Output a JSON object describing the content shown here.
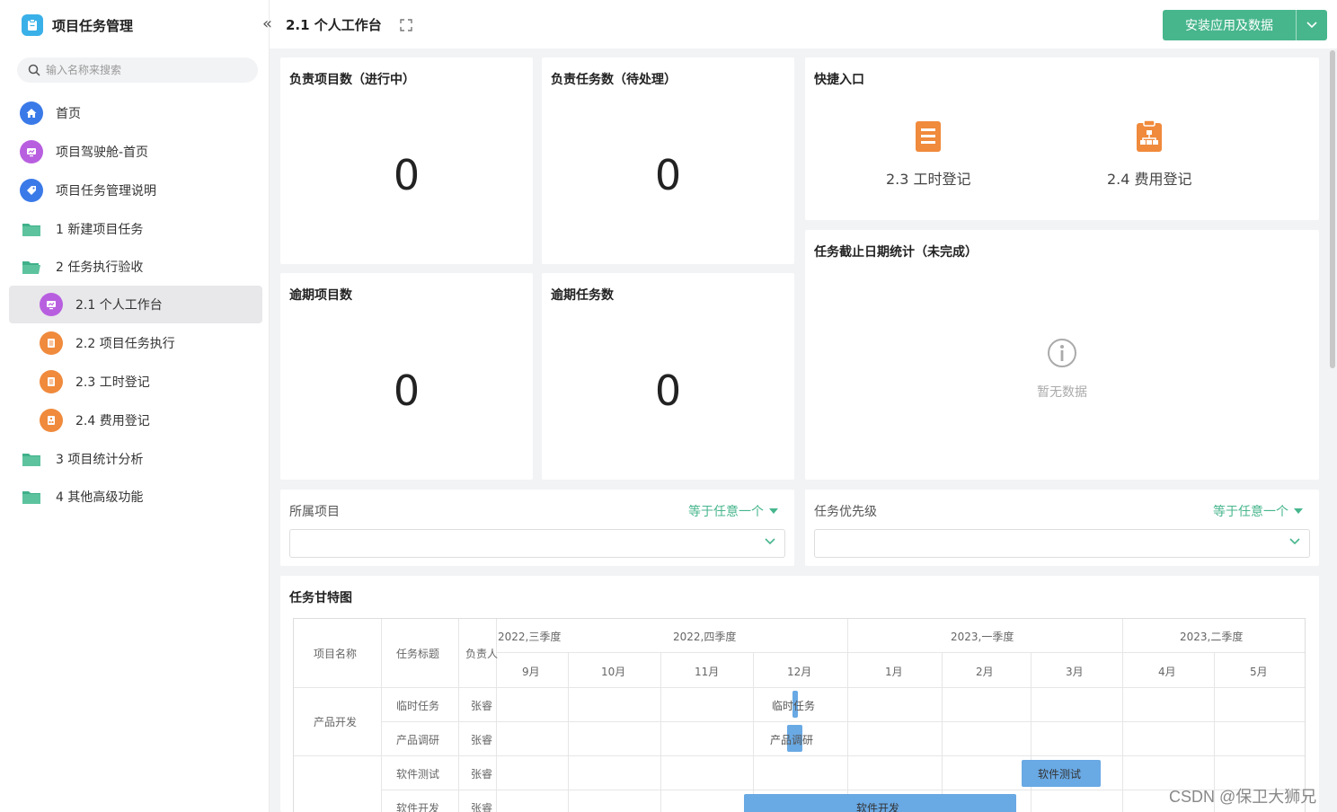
{
  "app": {
    "title": "项目任务管理"
  },
  "search": {
    "placeholder": "输入名称来搜索"
  },
  "sidebar": {
    "items": [
      {
        "label": "首页"
      },
      {
        "label": "项目驾驶舱-首页"
      },
      {
        "label": "项目任务管理说明"
      },
      {
        "label": "1 新建项目任务"
      },
      {
        "label": "2 任务执行验收"
      },
      {
        "label": "2.1 个人工作台"
      },
      {
        "label": "2.2 项目任务执行"
      },
      {
        "label": "2.3 工时登记"
      },
      {
        "label": "2.4 费用登记"
      },
      {
        "label": "3 项目统计分析"
      },
      {
        "label": "4 其他高级功能"
      }
    ]
  },
  "header": {
    "page_title": "2.1 个人工作台",
    "install_label": "安装应用及数据"
  },
  "stats": [
    {
      "title": "负责项目数（进行中）",
      "value": "0"
    },
    {
      "title": "负责任务数（待处理）",
      "value": "0"
    },
    {
      "title": "逾期项目数",
      "value": "0"
    },
    {
      "title": "逾期任务数",
      "value": "0"
    }
  ],
  "quick": {
    "title": "快捷入口",
    "items": [
      {
        "label": "2.3 工时登记",
        "icon": "document-icon"
      },
      {
        "label": "2.4 费用登记",
        "icon": "org-chart-icon"
      }
    ]
  },
  "deadline": {
    "title": "任务截止日期统计（未完成）",
    "empty_text": "暂无数据"
  },
  "filters": [
    {
      "label": "所属项目",
      "operator": "等于任意一个",
      "value": ""
    },
    {
      "label": "任务优先级",
      "operator": "等于任意一个",
      "value": ""
    }
  ],
  "gantt": {
    "title": "任务甘特图",
    "columns": [
      "项目名称",
      "任务标题",
      "负责人"
    ],
    "quarters": [
      "2022,三季度",
      "2022,四季度",
      "2023,一季度",
      "2023,二季度"
    ],
    "months": [
      "9月",
      "10月",
      "11月",
      "12月",
      "1月",
      "2月",
      "3月",
      "4月",
      "5月"
    ],
    "rows": [
      {
        "project": "产品开发",
        "task": "临时任务",
        "owner": "张睿",
        "bar": "临时任务"
      },
      {
        "project": "",
        "task": "产品调研",
        "owner": "张睿",
        "bar": "产品调研"
      },
      {
        "project": "",
        "task": "软件测试",
        "owner": "张睿",
        "bar": "软件测试"
      },
      {
        "project": "",
        "task": "软件开发",
        "owner": "张睿",
        "bar": "软件开发"
      }
    ]
  },
  "colors": {
    "accent": "#47b68d",
    "bar": "#69a9e4",
    "orange": "#f08a3c",
    "purple": "#b85fe0",
    "blue": "#3a7ae8",
    "folder": "#3fb08a"
  },
  "watermark": "CSDN @保卫大狮兄"
}
